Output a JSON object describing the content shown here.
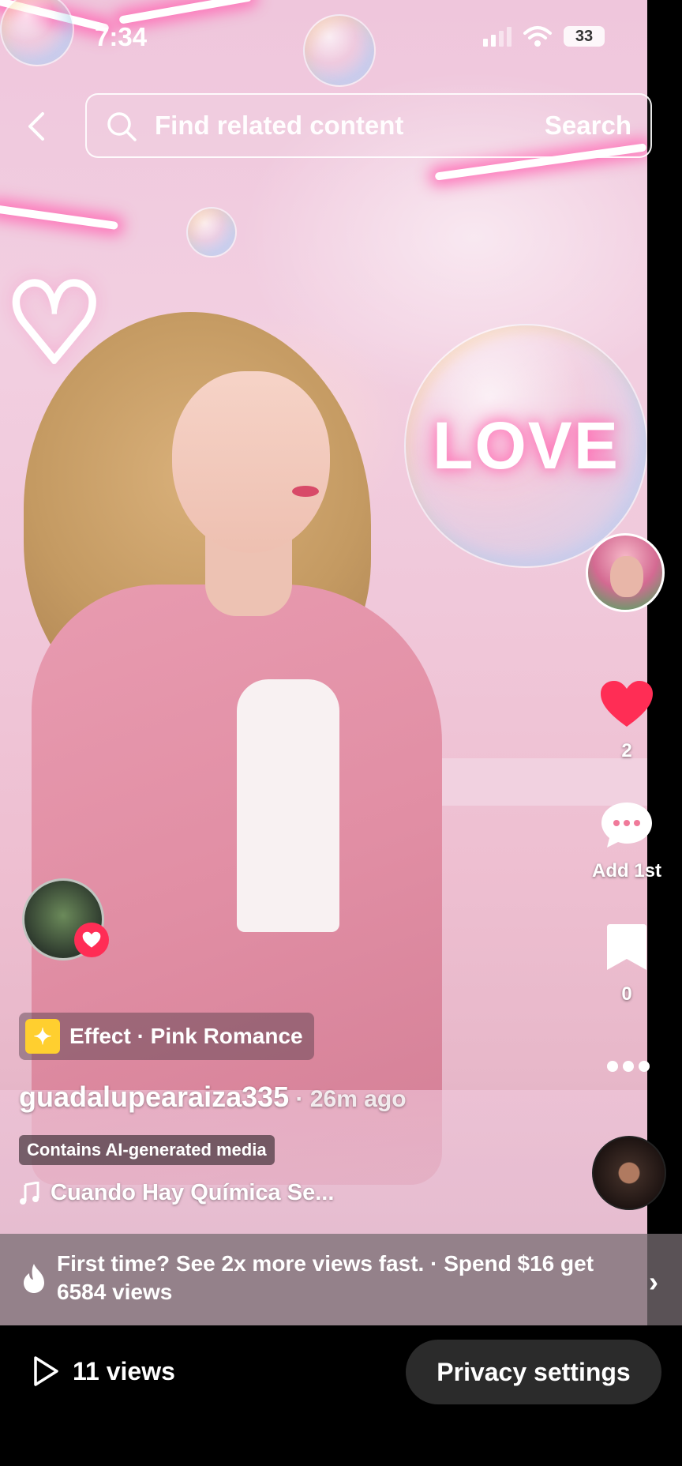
{
  "status_bar": {
    "time": "7:34",
    "battery": "33"
  },
  "search": {
    "placeholder": "Find related content",
    "button": "Search"
  },
  "video": {
    "overlay_text": "LOVE"
  },
  "actions": {
    "likes": "2",
    "comments": "Add 1st",
    "saves": "0"
  },
  "effect": {
    "label": "Effect · Pink Romance"
  },
  "post": {
    "username": "guadalupearaiza335",
    "time_ago": " · 26m ago",
    "ai_label": "Contains AI-generated media",
    "sound": "Cuando Hay Química Se..."
  },
  "promo": {
    "text": "First time? See 2x more views fast. · Spend $16 get 6584 views"
  },
  "bottom": {
    "views": "11 views",
    "privacy_button": "Privacy settings"
  },
  "colors": {
    "like": "#ff2d55",
    "effect_badge": "#ffcf2f",
    "bg_pink": "#f0c8da"
  }
}
